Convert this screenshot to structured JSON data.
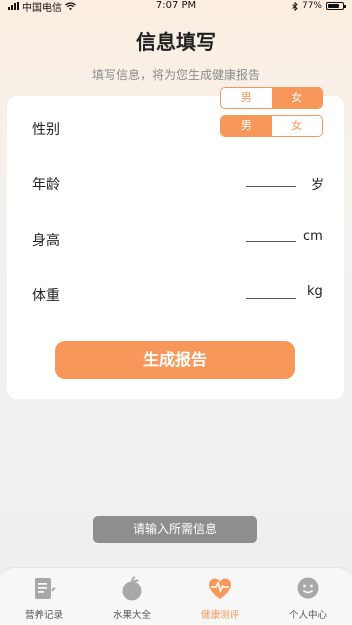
{
  "status_bar": {
    "carrier": "中国电信",
    "time": "7:07 PM",
    "battery": "77%",
    "battery_level": 0.77
  },
  "header": {
    "title": "信息填写",
    "subtitle": "填写信息，将为您生成健康报告"
  },
  "gender_toggle_top": {
    "male": "男",
    "female": "女",
    "selected": "female"
  },
  "form": {
    "gender_label": "性别",
    "gender_toggle": {
      "male": "男",
      "female": "女",
      "selected": "male"
    },
    "age_label": "年龄",
    "age_value": "",
    "age_unit": "岁",
    "height_label": "身高",
    "height_value": "",
    "height_unit": "cm",
    "weight_label": "体重",
    "weight_value": "",
    "weight_unit": "kg"
  },
  "generate_button": "生成报告",
  "toast": "请输入所需信息",
  "tab_bar": {
    "tabs": [
      {
        "label": "营养记录",
        "icon": "notes-icon",
        "active": false
      },
      {
        "label": "水果大全",
        "icon": "fruit-icon",
        "active": false
      },
      {
        "label": "健康测评",
        "icon": "heart-pulse-icon",
        "active": true
      },
      {
        "label": "个人中心",
        "icon": "smiley-face-icon",
        "active": false
      }
    ]
  },
  "colors": {
    "accent": "#f7985a",
    "toast_bg": "#8e8e8e",
    "inactive_icon": "#a8a8a8"
  }
}
